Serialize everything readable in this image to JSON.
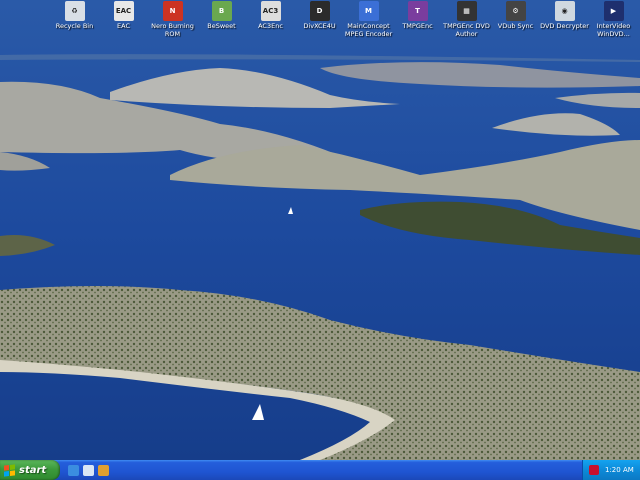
{
  "desktop": {
    "icons": [
      {
        "label": "Recycle Bin",
        "icon": "recycle-bin-icon",
        "color": "#d9dfe6",
        "glyph": "♻"
      },
      {
        "label": "EAC",
        "icon": "eac-icon",
        "color": "#e8e8e8",
        "glyph": "EAC"
      },
      {
        "label": "Nero Burning ROM",
        "icon": "nero-icon",
        "color": "#cc3322",
        "glyph": "N"
      },
      {
        "label": "BeSweet",
        "icon": "besweet-icon",
        "color": "#6aa84f",
        "glyph": "B"
      },
      {
        "label": "AC3Enc",
        "icon": "ac3enc-icon",
        "color": "#dddddd",
        "glyph": "AC3"
      },
      {
        "label": "DivXCE4U",
        "icon": "divx-icon",
        "color": "#2b2b2b",
        "glyph": "D"
      },
      {
        "label": "MainConcept MPEG Encoder",
        "icon": "mainconcept-icon",
        "color": "#3b6fd6",
        "glyph": "M"
      },
      {
        "label": "TMPGEnc",
        "icon": "tmpgenc-icon",
        "color": "#7a3d9e",
        "glyph": "T"
      },
      {
        "label": "TMPGEnc DVD Author",
        "icon": "tmpgenc-dvd-author-icon",
        "color": "#333333",
        "glyph": "▦"
      },
      {
        "label": "VDub Sync",
        "icon": "vdub-sync-icon",
        "color": "#444444",
        "glyph": "⚙"
      },
      {
        "label": "DVD Decrypter",
        "icon": "dvd-decrypter-icon",
        "color": "#cfd8e0",
        "glyph": "◉"
      },
      {
        "label": "InterVideo WinDVD...",
        "icon": "windvd-icon",
        "color": "#1e2f6e",
        "glyph": "▶"
      }
    ]
  },
  "taskbar": {
    "start_label": "start",
    "quick_launch": [
      {
        "icon": "ie-icon",
        "color": "#3b8de0"
      },
      {
        "icon": "show-desktop-icon",
        "color": "#d9e6f5"
      },
      {
        "icon": "media-player-icon",
        "color": "#e0a030"
      }
    ],
    "tray_icon": "volume-icon",
    "clock": "1:20 AM"
  }
}
